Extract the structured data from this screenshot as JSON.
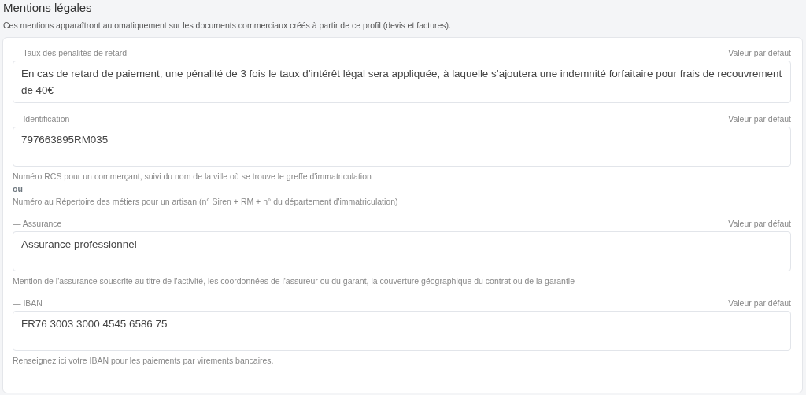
{
  "section": {
    "title": "Mentions légales",
    "subtitle": "Ces mentions apparaîtront automatiquement sur les documents commerciaux créés à partir de ce profil (devis et factures)."
  },
  "fields": [
    {
      "label": "— Taux des pénalités de retard",
      "default_link": "Valeur par défaut",
      "value": "En cas de retard de paiement, une pénalité de 3 fois le taux d’intérêt légal sera appliquée, à laquelle s’ajoutera une indemnité forfaitaire pour frais de recouvrement de 40€"
    },
    {
      "label": "— Identification",
      "default_link": "Valeur par défaut",
      "value": "797663895RM035",
      "help": [
        {
          "text": "Numéro RCS pour un commerçant, suivi du nom de la ville où se trouve le greffe d'immatriculation",
          "bold": false
        },
        {
          "text": "ou",
          "bold": true
        },
        {
          "text": "Numéro au Répertoire des métiers pour un artisan (n° Siren + RM + n° du département d'immatriculation)",
          "bold": false
        }
      ]
    },
    {
      "label": "— Assurance",
      "default_link": "Valeur par défaut",
      "value": "Assurance professionnel",
      "help": [
        {
          "text": "Mention de l'assurance souscrite au titre de l'activité, les coordonnées de l'assureur ou du garant, la couverture géographique du contrat ou de la garantie",
          "bold": false
        }
      ]
    },
    {
      "label": "— IBAN",
      "default_link": "Valeur par défaut",
      "value": "FR76 3003 3000 4545 6586 75",
      "help": [
        {
          "text": "Renseignez ici votre IBAN pour les paiements par virements bancaires.",
          "bold": false
        }
      ]
    }
  ]
}
